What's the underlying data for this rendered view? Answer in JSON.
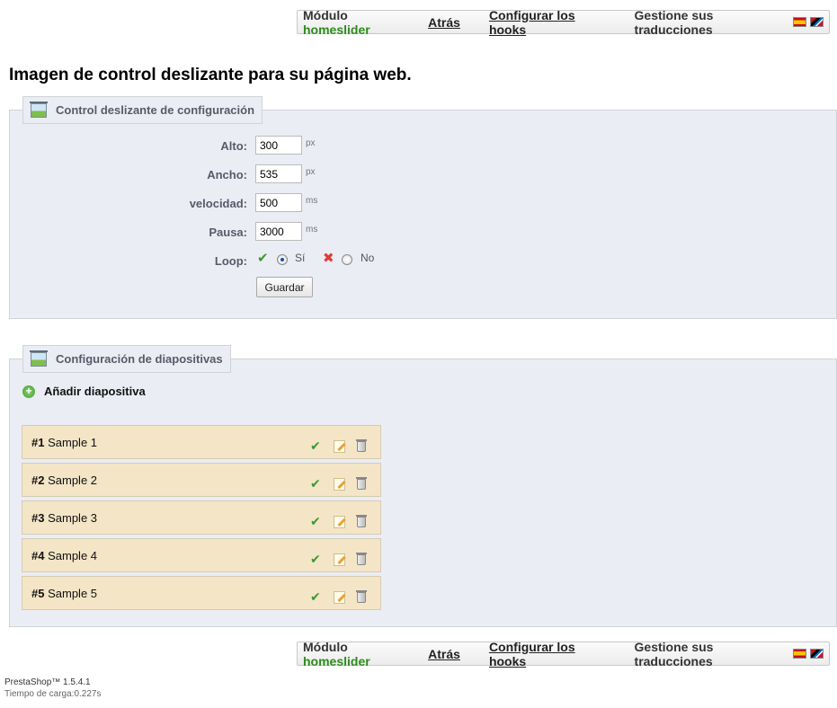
{
  "toolbar": {
    "module_prefix": "Módulo",
    "module_name": "homeslider",
    "back": "Atrás",
    "configure_hooks": "Configurar los hooks",
    "manage_translations": "Gestione sus traducciones",
    "flags": [
      "flag-es-icon",
      "flag-ag-icon"
    ]
  },
  "page_title": "Imagen de control deslizante para su página web.",
  "config": {
    "legend": "Control deslizante de configuración",
    "fields": [
      {
        "label": "Alto:",
        "value": "300",
        "unit": "px"
      },
      {
        "label": "Ancho:",
        "value": "535",
        "unit": "px"
      },
      {
        "label": "velocidad:",
        "value": "500",
        "unit": "ms"
      },
      {
        "label": "Pausa:",
        "value": "3000",
        "unit": "ms"
      }
    ],
    "loop": {
      "label": "Loop:",
      "yes": "Sí",
      "no": "No",
      "selected": "yes"
    },
    "save": "Guardar"
  },
  "slides": {
    "legend": "Configuración de diapositivas",
    "add": "Añadir diapositiva",
    "items": [
      {
        "num": "#1",
        "name": "Sample 1"
      },
      {
        "num": "#2",
        "name": "Sample 2"
      },
      {
        "num": "#3",
        "name": "Sample 3"
      },
      {
        "num": "#4",
        "name": "Sample 4"
      },
      {
        "num": "#5",
        "name": "Sample 5"
      }
    ]
  },
  "footer": {
    "version": "PrestaShop™ 1.5.4.1",
    "load_time": "Tiempo de carga:0.227s"
  }
}
